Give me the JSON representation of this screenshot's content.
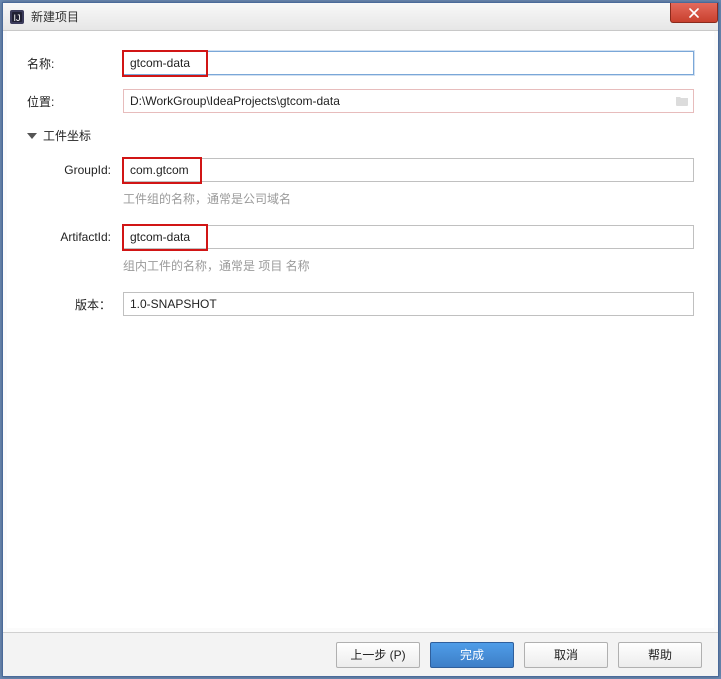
{
  "window": {
    "title": "新建项目"
  },
  "form": {
    "name_label": "名称:",
    "name_value": "gtcom-data",
    "location_label": "位置:",
    "location_value": "D:\\WorkGroup\\IdeaProjects\\gtcom-data"
  },
  "section": {
    "title": "工件坐标"
  },
  "artifact": {
    "groupid_label": "GroupId:",
    "groupid_value": "com.gtcom",
    "groupid_hint": "工件组的名称，通常是公司域名",
    "artifactid_label": "ArtifactId:",
    "artifactid_value": "gtcom-data",
    "artifactid_hint": "组内工件的名称，通常是 项目 名称",
    "version_label": "版本：",
    "version_value": "1.0-SNAPSHOT"
  },
  "buttons": {
    "prev": "上一步 (P)",
    "finish": "完成",
    "cancel": "取消",
    "help": "帮助"
  },
  "colors": {
    "highlight": "#d11515",
    "primary": "#3d7ec7"
  }
}
